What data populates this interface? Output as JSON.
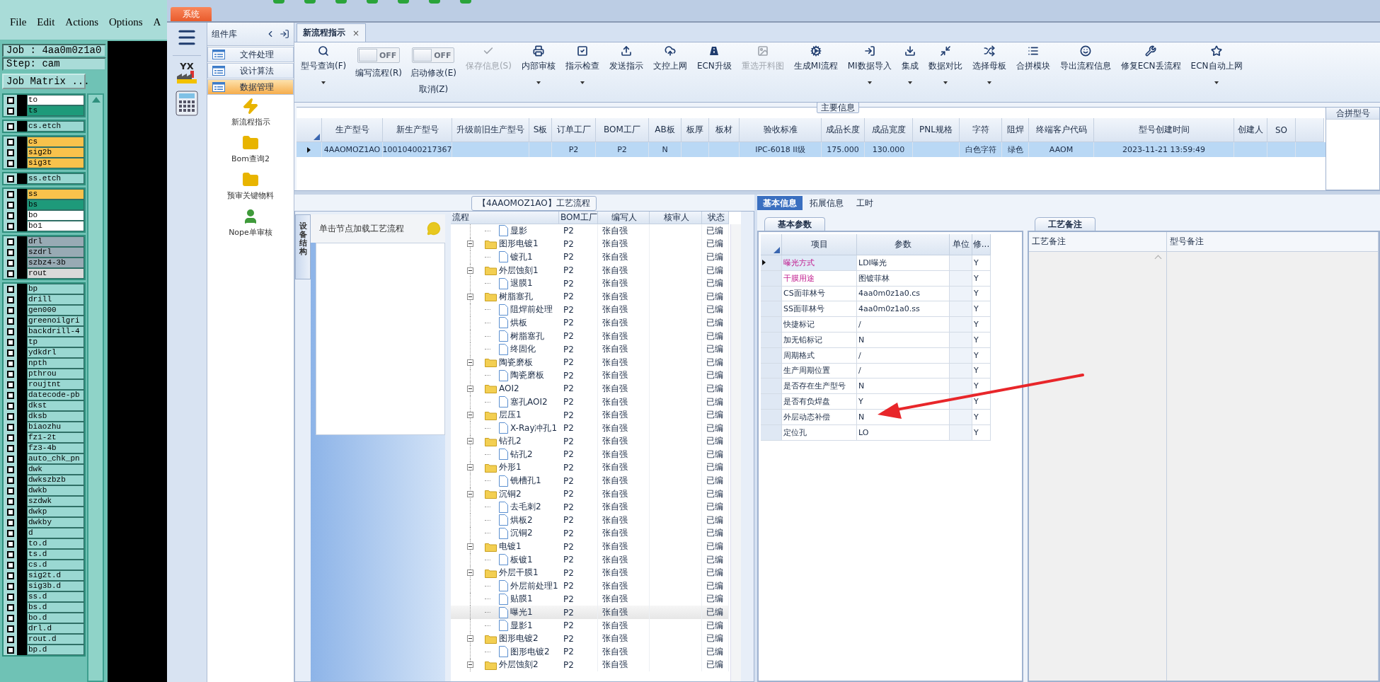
{
  "cam": {
    "menu": [
      "File",
      "Edit",
      "Actions",
      "Options",
      "A"
    ],
    "job": "Job : 4aa0m0z1a0",
    "step": "Step: cam",
    "matrix_button": "Job Matrix ...",
    "layer_groups": [
      {
        "layers": [
          {
            "name": "to",
            "color": "#ffffff",
            "checked": false
          },
          {
            "name": "ts",
            "color": "#1e9a7a",
            "checked": false
          }
        ]
      },
      {
        "layers": [
          {
            "name": "cs.etch",
            "color": "#9ad8d2",
            "checked": false
          }
        ]
      },
      {
        "layers": [
          {
            "name": "cs",
            "color": "#f8c24c",
            "checked": false
          },
          {
            "name": "sig2b",
            "color": "#f8c24c",
            "checked": false
          },
          {
            "name": "sig3t",
            "color": "#f8c24c",
            "checked": false
          }
        ]
      },
      {
        "layers": [
          {
            "name": "ss.etch",
            "color": "#9ad8d2",
            "checked": false
          }
        ]
      },
      {
        "layers": [
          {
            "name": "ss",
            "color": "#f8c24c",
            "checked": false
          },
          {
            "name": "bs",
            "color": "#1e9a7a",
            "checked": false
          },
          {
            "name": "bo",
            "color": "#ffffff",
            "checked": false
          },
          {
            "name": "bo1",
            "color": "#ffffff",
            "checked": false
          }
        ]
      },
      {
        "layers": [
          {
            "name": "drl",
            "color": "#98aab4",
            "checked": false
          },
          {
            "name": "szdrl",
            "color": "#98aab4",
            "checked": false
          },
          {
            "name": "szbz4-3b",
            "color": "#98aab4",
            "checked": false
          },
          {
            "name": "rout",
            "color": "#d9d9d9",
            "checked": false
          }
        ]
      },
      {
        "layers": [
          {
            "name": "bp",
            "color": "#9ad8d2",
            "checked": false
          },
          {
            "name": "drill",
            "color": "#9ad8d2",
            "checked": false
          },
          {
            "name": "gen000",
            "color": "#9ad8d2",
            "checked": false
          },
          {
            "name": "greenoilgri",
            "color": "#9ad8d2",
            "checked": false
          },
          {
            "name": "backdrill-4",
            "color": "#9ad8d2",
            "checked": false
          },
          {
            "name": "tp",
            "color": "#9ad8d2",
            "checked": false
          },
          {
            "name": "ydkdrl",
            "color": "#9ad8d2",
            "checked": false
          },
          {
            "name": "npth",
            "color": "#9ad8d2",
            "checked": false
          },
          {
            "name": "pthrou",
            "color": "#9ad8d2",
            "checked": false
          },
          {
            "name": "roujtnt",
            "color": "#9ad8d2",
            "checked": false
          },
          {
            "name": "datecode-pb",
            "color": "#9ad8d2",
            "checked": false
          },
          {
            "name": "dkst",
            "color": "#9ad8d2",
            "checked": false
          },
          {
            "name": "dksb",
            "color": "#9ad8d2",
            "checked": false
          },
          {
            "name": "biaozhu",
            "color": "#9ad8d2",
            "checked": false
          },
          {
            "name": "fz1-2t",
            "color": "#9ad8d2",
            "checked": false
          },
          {
            "name": "fz3-4b",
            "color": "#9ad8d2",
            "checked": false
          },
          {
            "name": "auto_chk_pn",
            "color": "#9ad8d2",
            "checked": false
          },
          {
            "name": "dwk",
            "color": "#9ad8d2",
            "checked": false
          },
          {
            "name": "dwkszbzb",
            "color": "#9ad8d2",
            "checked": false
          },
          {
            "name": "dwkb",
            "color": "#9ad8d2",
            "checked": false
          },
          {
            "name": "szdwk",
            "color": "#9ad8d2",
            "checked": false
          },
          {
            "name": "dwkp",
            "color": "#9ad8d2",
            "checked": false
          },
          {
            "name": "dwkby",
            "color": "#9ad8d2",
            "checked": false
          },
          {
            "name": "d",
            "color": "#9ad8d2",
            "checked": false
          },
          {
            "name": "to.d",
            "color": "#9ad8d2",
            "checked": false
          },
          {
            "name": "ts.d",
            "color": "#9ad8d2",
            "checked": false
          },
          {
            "name": "cs.d",
            "color": "#9ad8d2",
            "checked": false
          },
          {
            "name": "sig2t.d",
            "color": "#9ad8d2",
            "checked": false
          },
          {
            "name": "sig3b.d",
            "color": "#9ad8d2",
            "checked": false
          },
          {
            "name": "ss.d",
            "color": "#9ad8d2",
            "checked": false
          },
          {
            "name": "bs.d",
            "color": "#9ad8d2",
            "checked": false
          },
          {
            "name": "bo.d",
            "color": "#9ad8d2",
            "checked": false
          },
          {
            "name": "drl.d",
            "color": "#9ad8d2",
            "checked": false
          },
          {
            "name": "rout.d",
            "color": "#9ad8d2",
            "checked": false
          },
          {
            "name": "bp.d",
            "color": "#9ad8d2",
            "checked": false
          }
        ]
      }
    ]
  },
  "system_tab": "系统",
  "logo_text": "YX",
  "nav_panel": {
    "title": "组件库",
    "categories": [
      {
        "label": "文件处理",
        "selected": false
      },
      {
        "label": "设计算法",
        "selected": false
      },
      {
        "label": "数据管理",
        "selected": true
      }
    ],
    "tools": [
      {
        "label": "新流程指示"
      },
      {
        "label": "Bom查询2"
      },
      {
        "label": "预审关键物料"
      },
      {
        "label": "Nope单审核"
      }
    ]
  },
  "document_tabs": [
    {
      "label": "新流程指示",
      "close": "×",
      "selected": true
    }
  ],
  "toolbar": [
    {
      "kind": "button",
      "label": "型号查询(F)",
      "dropdown": true,
      "disabled": false
    },
    {
      "kind": "toggle",
      "state": "OFF",
      "on": false,
      "labels": [
        "编写流程(R)"
      ]
    },
    {
      "kind": "toggle",
      "state": "OFF",
      "on": false,
      "labels": [
        "启动修改(E)",
        "取消(Z)"
      ]
    },
    {
      "kind": "button",
      "label": "保存信息(S)",
      "dropdown": false,
      "disabled": true
    },
    {
      "kind": "button",
      "label": "内部审核",
      "dropdown": true,
      "disabled": false
    },
    {
      "kind": "button",
      "label": "指示检查",
      "dropdown": true,
      "disabled": false
    },
    {
      "kind": "button",
      "label": "发送指示",
      "dropdown": false,
      "disabled": false
    },
    {
      "kind": "button",
      "label": "文控上网",
      "dropdown": false,
      "disabled": false
    },
    {
      "kind": "button",
      "label": "ECN升级",
      "dropdown": false,
      "disabled": false
    },
    {
      "kind": "button",
      "label": "重选开料图",
      "dropdown": false,
      "disabled": true
    },
    {
      "kind": "button",
      "label": "生成MI流程",
      "dropdown": false,
      "disabled": false
    },
    {
      "kind": "button",
      "label": "MI数据导入",
      "dropdown": true,
      "disabled": false
    },
    {
      "kind": "button",
      "label": "集成",
      "dropdown": true,
      "disabled": false
    },
    {
      "kind": "button",
      "label": "数据对比",
      "dropdown": true,
      "disabled": false
    },
    {
      "kind": "button",
      "label": "选择母板",
      "dropdown": true,
      "disabled": false
    },
    {
      "kind": "button",
      "label": "合拼模块",
      "dropdown": false,
      "disabled": false
    },
    {
      "kind": "button",
      "label": "导出流程信息",
      "dropdown": false,
      "disabled": false
    },
    {
      "kind": "button",
      "label": "修复ECN丢流程",
      "dropdown": false,
      "disabled": false
    },
    {
      "kind": "button",
      "label": "ECN自动上网",
      "dropdown": true,
      "disabled": false
    }
  ],
  "main_info": {
    "title": "主要信息",
    "columns": [
      "生产型号",
      "新生产型号",
      "升级前旧生产型号",
      "S板",
      "订单工厂",
      "BOM工厂",
      "AB板",
      "板厚",
      "板材",
      "验收标准",
      "成品长度",
      "成品宽度",
      "PNL规格",
      "字符",
      "阻焊",
      "终端客户代码",
      "型号创建时间",
      "创建人",
      "SO"
    ],
    "rows": [
      {
        "selected": true,
        "cells": [
          "4AAOMOZ1AO",
          "10010400217367",
          "",
          "",
          "P2",
          "P2",
          "N",
          "",
          "",
          "IPC-6018 II级",
          "175.000",
          "130.000",
          "",
          "白色字符",
          "绿色",
          "AAOM",
          "2023-11-21 13:59:49",
          "",
          ""
        ]
      }
    ],
    "merge_panel": {
      "title": "合拼型号"
    }
  },
  "process_panel": {
    "title": "【4AAOMOZ1AO】工艺流程",
    "side_tab": "设备结构",
    "hint": "单击节点加载工艺流程",
    "tree": {
      "columns": [
        "流程",
        "BOM工厂",
        "编写人",
        "核审人",
        "状态"
      ],
      "continued_children": [
        {
          "name": "显影",
          "factory": "P2",
          "writer": "张自强",
          "status": "已编",
          "selected": false
        }
      ],
      "nodes": [
        {
          "name": "图形电镀1",
          "factory": "P2",
          "writer": "张自强",
          "status": "已编",
          "selected": false,
          "expanded": true,
          "children": [
            {
              "name": "镀孔1",
              "factory": "P2",
              "writer": "张自强",
              "status": "已编",
              "selected": false
            }
          ]
        },
        {
          "name": "外层蚀刻1",
          "factory": "P2",
          "writer": "张自强",
          "status": "已编",
          "selected": false,
          "expanded": true,
          "children": [
            {
              "name": "退膜1",
              "factory": "P2",
              "writer": "张自强",
              "status": "已编",
              "selected": false
            }
          ]
        },
        {
          "name": "树脂塞孔",
          "factory": "P2",
          "writer": "张自强",
          "status": "已编",
          "selected": false,
          "expanded": true,
          "children": [
            {
              "name": "阻焊前处理",
              "factory": "P2",
              "writer": "张自强",
              "status": "已编",
              "selected": false
            },
            {
              "name": "烘板",
              "factory": "P2",
              "writer": "张自强",
              "status": "已编",
              "selected": false
            },
            {
              "name": "树脂塞孔",
              "factory": "P2",
              "writer": "张自强",
              "status": "已编",
              "selected": false
            },
            {
              "name": "终固化",
              "factory": "P2",
              "writer": "张自强",
              "status": "已编",
              "selected": false
            }
          ]
        },
        {
          "name": "陶瓷磨板",
          "factory": "P2",
          "writer": "张自强",
          "status": "已编",
          "selected": false,
          "expanded": true,
          "children": [
            {
              "name": "陶瓷磨板",
              "factory": "P2",
              "writer": "张自强",
              "status": "已编",
              "selected": false
            }
          ]
        },
        {
          "name": "AOI2",
          "factory": "P2",
          "writer": "张自强",
          "status": "已编",
          "selected": false,
          "expanded": true,
          "children": [
            {
              "name": "塞孔AOI2",
              "factory": "P2",
              "writer": "张自强",
              "status": "已编",
              "selected": false
            }
          ]
        },
        {
          "name": "层压1",
          "factory": "P2",
          "writer": "张自强",
          "status": "已编",
          "selected": false,
          "expanded": true,
          "children": [
            {
              "name": "X-Ray冲孔1",
              "factory": "P2",
              "writer": "张自强",
              "status": "已编",
              "selected": false
            }
          ]
        },
        {
          "name": "钻孔2",
          "factory": "P2",
          "writer": "张自强",
          "status": "已编",
          "selected": false,
          "expanded": true,
          "children": [
            {
              "name": "钻孔2",
              "factory": "P2",
              "writer": "张自强",
              "status": "已编",
              "selected": false
            }
          ]
        },
        {
          "name": "外形1",
          "factory": "P2",
          "writer": "张自强",
          "status": "已编",
          "selected": false,
          "expanded": true,
          "children": [
            {
              "name": "铣槽孔1",
              "factory": "P2",
              "writer": "张自强",
              "status": "已编",
              "selected": false
            }
          ]
        },
        {
          "name": "沉铜2",
          "factory": "P2",
          "writer": "张自强",
          "status": "已编",
          "selected": false,
          "expanded": true,
          "children": [
            {
              "name": "去毛刺2",
              "factory": "P2",
              "writer": "张自强",
              "status": "已编",
              "selected": false
            },
            {
              "name": "烘板2",
              "factory": "P2",
              "writer": "张自强",
              "status": "已编",
              "selected": false
            },
            {
              "name": "沉铜2",
              "factory": "P2",
              "writer": "张自强",
              "status": "已编",
              "selected": false
            }
          ]
        },
        {
          "name": "电镀1",
          "factory": "P2",
          "writer": "张自强",
          "status": "已编",
          "selected": false,
          "expanded": true,
          "children": [
            {
              "name": "板镀1",
              "factory": "P2",
              "writer": "张自强",
              "status": "已编",
              "selected": false
            }
          ]
        },
        {
          "name": "外层干膜1",
          "factory": "P2",
          "writer": "张自强",
          "status": "已编",
          "selected": false,
          "expanded": true,
          "children": [
            {
              "name": "外层前处理1",
              "factory": "P2",
              "writer": "张自强",
              "status": "已编",
              "selected": false
            },
            {
              "name": "贴膜1",
              "factory": "P2",
              "writer": "张自强",
              "status": "已编",
              "selected": false
            },
            {
              "name": "曝光1",
              "factory": "P2",
              "writer": "张自强",
              "status": "已编",
              "selected": true
            },
            {
              "name": "显影1",
              "factory": "P2",
              "writer": "张自强",
              "status": "已编",
              "selected": false
            }
          ]
        },
        {
          "name": "图形电镀2",
          "factory": "P2",
          "writer": "张自强",
          "status": "已编",
          "selected": false,
          "expanded": true,
          "children": [
            {
              "name": "图形电镀2",
              "factory": "P2",
              "writer": "张自强",
              "status": "已编",
              "selected": false
            }
          ]
        },
        {
          "name": "外层蚀刻2",
          "factory": "P2",
          "writer": "张自强",
          "status": "已编",
          "selected": false,
          "expanded": true
        }
      ]
    }
  },
  "detail": {
    "tabs": [
      {
        "label": "基本信息",
        "selected": true
      },
      {
        "label": "拓展信息",
        "selected": false
      },
      {
        "label": "工时",
        "selected": false
      }
    ],
    "basic_params": {
      "tab": "基本参数",
      "columns": [
        "项目",
        "参数",
        "单位",
        "修..."
      ],
      "rows": [
        {
          "item": "曝光方式",
          "value": "LDI曝光",
          "modify": "Y",
          "required": true,
          "current": true
        },
        {
          "item": "干膜用途",
          "value": "图镀菲林",
          "modify": "Y",
          "required": true,
          "current": false
        },
        {
          "item": "CS面菲林号",
          "value": "4aa0m0z1a0.cs",
          "modify": "Y",
          "required": false,
          "current": false
        },
        {
          "item": "SS面菲林号",
          "value": "4aa0m0z1a0.ss",
          "modify": "Y",
          "required": false,
          "current": false
        },
        {
          "item": "快捷标记",
          "value": "/",
          "modify": "Y",
          "required": false,
          "current": false
        },
        {
          "item": "加无铅标记",
          "value": "N",
          "modify": "Y",
          "required": false,
          "current": false
        },
        {
          "item": "周期格式",
          "value": "/",
          "modify": "Y",
          "required": false,
          "current": false
        },
        {
          "item": "生产周期位置",
          "value": "/",
          "modify": "Y",
          "required": false,
          "current": false
        },
        {
          "item": "是否存在生产型号",
          "value": "N",
          "modify": "Y",
          "required": false,
          "current": false
        },
        {
          "item": "是否有负焊盘",
          "value": "Y",
          "modify": "Y",
          "required": false,
          "current": false
        },
        {
          "item": "外层动态补偿",
          "value": "N",
          "modify": "Y",
          "required": false,
          "current": false
        },
        {
          "item": "定位孔",
          "value": "LO",
          "modify": "Y",
          "required": false,
          "current": false
        }
      ]
    },
    "remarks": {
      "tab": "工艺备注",
      "columns": [
        "工艺备注",
        "型号备注"
      ]
    }
  }
}
